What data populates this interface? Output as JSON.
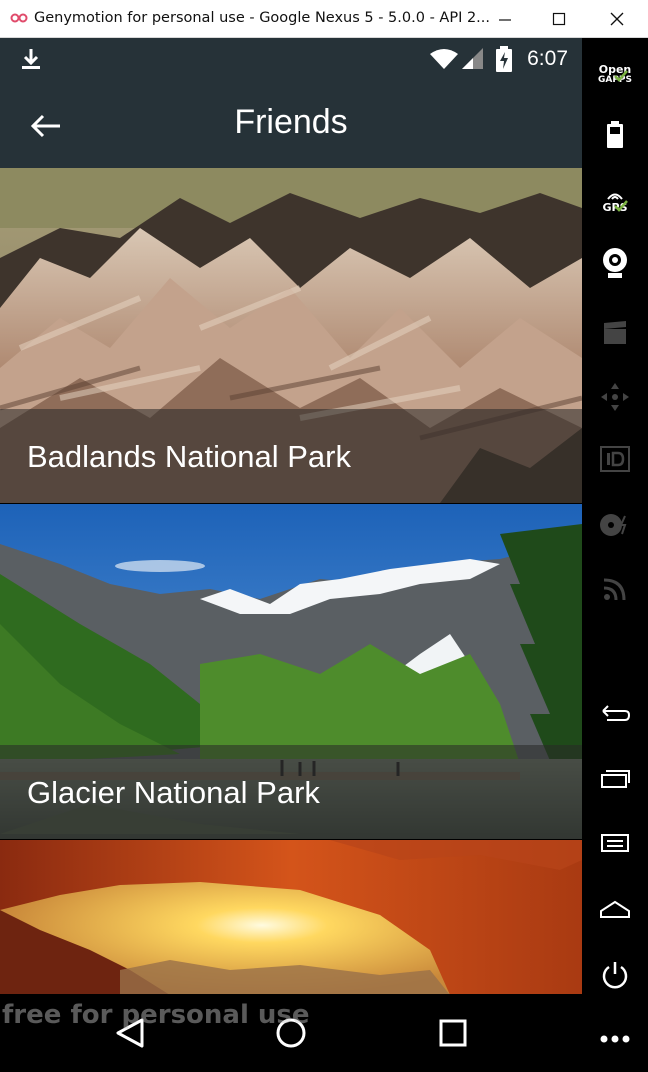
{
  "window": {
    "title": "Genymotion for personal use - Google Nexus 5 - 5.0.0 - API 2...",
    "watermark": "free for personal use"
  },
  "statusbar": {
    "time": "6:07"
  },
  "appbar": {
    "title": "Friends"
  },
  "cards": [
    {
      "title": "Badlands National Park"
    },
    {
      "title": "Glacier National Park"
    },
    {
      "title": ""
    }
  ],
  "sidebar": {
    "opengapps_label_top": "Open",
    "opengapps_label_bottom": "GAPPS",
    "gps_label": "GPS"
  },
  "colors": {
    "toolbar": "#263238",
    "accent_check": "#7cb342"
  }
}
